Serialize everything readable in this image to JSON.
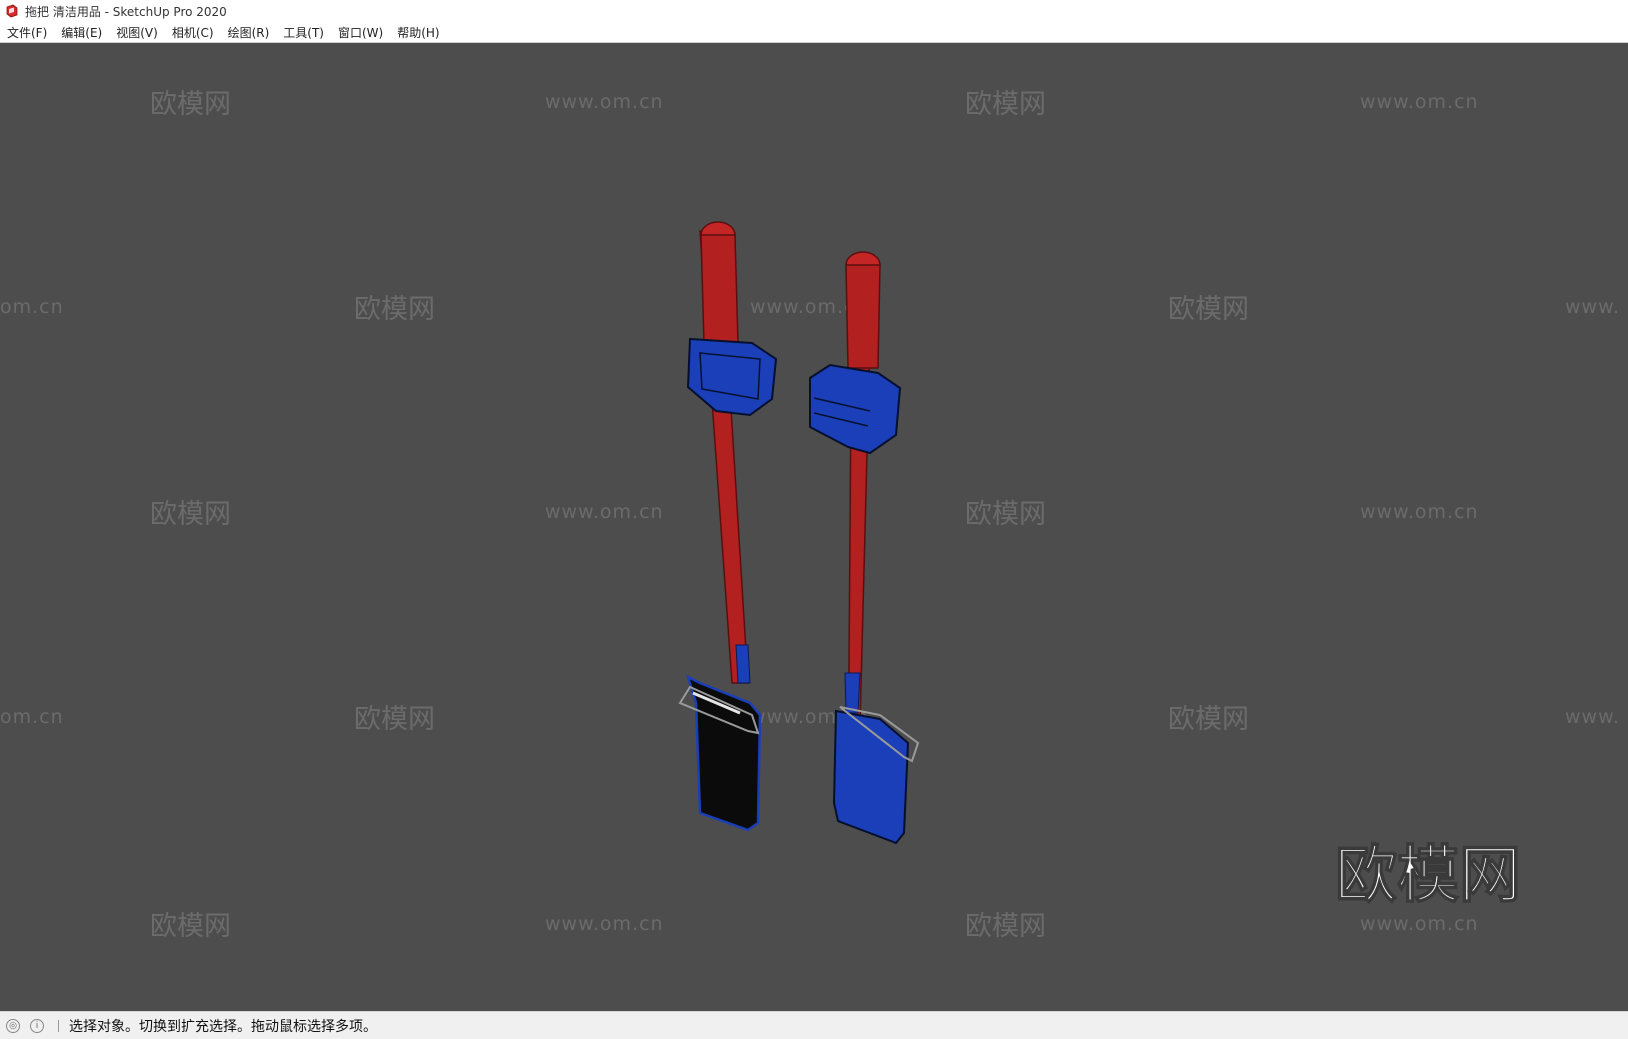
{
  "window": {
    "title": "拖把 清洁用品 - SketchUp Pro 2020",
    "icon": "sketchup-logo-icon"
  },
  "menubar": {
    "items": [
      "文件(F)",
      "编辑(E)",
      "视图(V)",
      "相机(C)",
      "绘图(R)",
      "工具(T)",
      "窗口(W)",
      "帮助(H)"
    ]
  },
  "viewport": {
    "background": "#4d4d4d",
    "watermark_logo": "欧模网",
    "watermark_url": "www.om.cn",
    "watermark_partial_url_left": "om.cn",
    "watermark_partial_url_right": "www.",
    "watermark_big": "欧模网",
    "model_colors": {
      "handle": "#b32020",
      "head": "#1a3fb8",
      "pad": "#0b0b0b"
    }
  },
  "statusbar": {
    "icons": [
      "geo-location-icon",
      "info-icon"
    ],
    "text": "选择对象。切换到扩充选择。拖动鼠标选择多项。"
  }
}
